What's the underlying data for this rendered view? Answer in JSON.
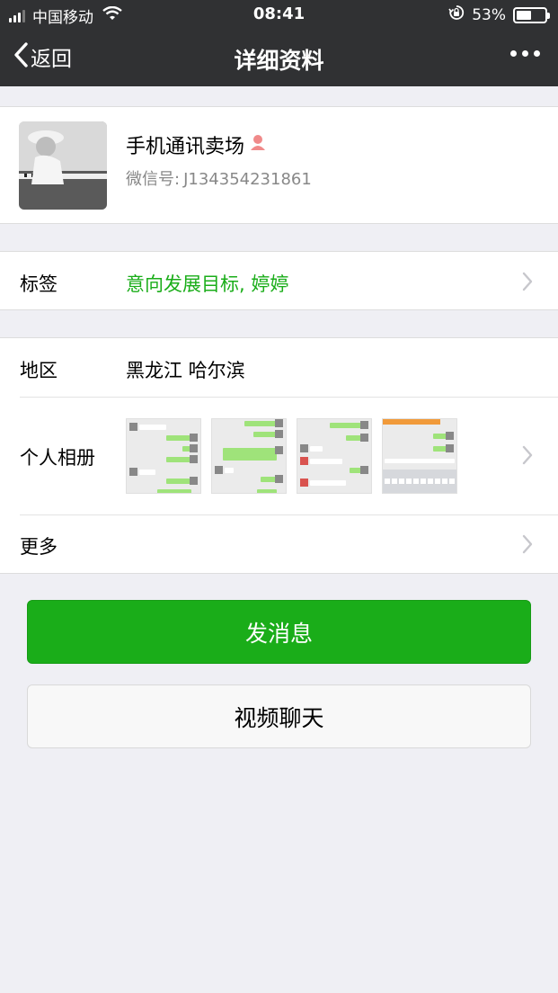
{
  "status_bar": {
    "carrier": "中国移动",
    "time": "08:41",
    "battery_percent": "53%",
    "battery_level": 0.53,
    "icons": [
      "signal-icon",
      "wifi-icon",
      "rotation-lock-icon",
      "battery-icon"
    ]
  },
  "nav": {
    "back_label": "返回",
    "title": "详细资料",
    "back_icon": "chevron-left-icon",
    "more_icon": "more-dots-icon"
  },
  "profile": {
    "nickname": "手机通讯卖场",
    "gender_icon": "female-icon",
    "wxid_label": "微信号:",
    "wxid_value": "J134354231861"
  },
  "tags": {
    "label": "标签",
    "value": "意向发展目标, 婷婷"
  },
  "region": {
    "label": "地区",
    "value": "黑龙江 哈尔滨"
  },
  "album": {
    "label": "个人相册",
    "thumbnail_count": 4
  },
  "more": {
    "label": "更多"
  },
  "actions": {
    "send_message": "发消息",
    "video_chat": "视频聊天"
  },
  "colors": {
    "nav_background": "#303133",
    "page_background": "#efeff4",
    "accent_green": "#1aad19",
    "tag_text": "#1aad19",
    "female_icon": "#f08a8a"
  }
}
